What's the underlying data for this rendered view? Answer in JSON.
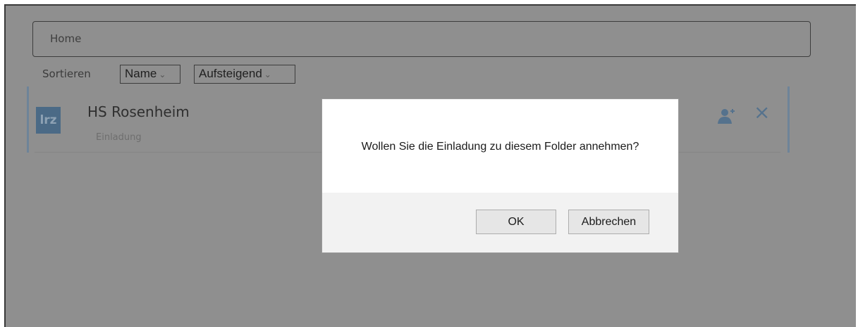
{
  "breadcrumb": {
    "text": "Home"
  },
  "sort": {
    "label": "Sortieren",
    "field_selected": "Name",
    "order_selected": "Aufsteigend"
  },
  "folder": {
    "logo_text": "lrz",
    "title": "HS Rosenheim",
    "subtitle": "Einladung",
    "accept_icon": "user-accept-icon",
    "decline_icon": "close-icon"
  },
  "dialog": {
    "message": "Wollen Sie die Einladung zu diesem Folder annehmen?",
    "ok_label": "OK",
    "cancel_label": "Abbrechen"
  },
  "colors": {
    "overlay": "#8f8f8f",
    "accent": "#6e8499",
    "logo": "#4b6a86"
  }
}
